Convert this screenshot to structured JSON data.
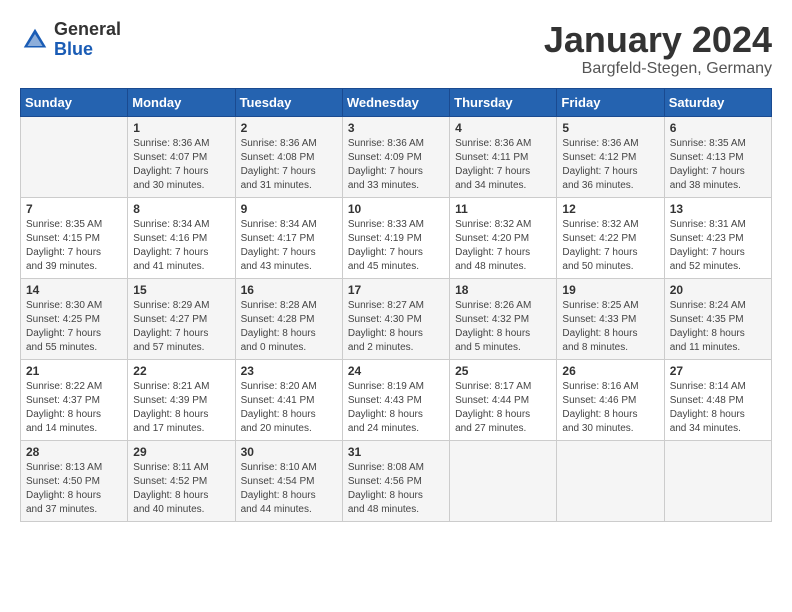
{
  "logo": {
    "general": "General",
    "blue": "Blue"
  },
  "title": {
    "month": "January 2024",
    "location": "Bargfeld-Stegen, Germany"
  },
  "days_of_week": [
    "Sunday",
    "Monday",
    "Tuesday",
    "Wednesday",
    "Thursday",
    "Friday",
    "Saturday"
  ],
  "weeks": [
    [
      {
        "day": "",
        "info": ""
      },
      {
        "day": "1",
        "info": "Sunrise: 8:36 AM\nSunset: 4:07 PM\nDaylight: 7 hours\nand 30 minutes."
      },
      {
        "day": "2",
        "info": "Sunrise: 8:36 AM\nSunset: 4:08 PM\nDaylight: 7 hours\nand 31 minutes."
      },
      {
        "day": "3",
        "info": "Sunrise: 8:36 AM\nSunset: 4:09 PM\nDaylight: 7 hours\nand 33 minutes."
      },
      {
        "day": "4",
        "info": "Sunrise: 8:36 AM\nSunset: 4:11 PM\nDaylight: 7 hours\nand 34 minutes."
      },
      {
        "day": "5",
        "info": "Sunrise: 8:36 AM\nSunset: 4:12 PM\nDaylight: 7 hours\nand 36 minutes."
      },
      {
        "day": "6",
        "info": "Sunrise: 8:35 AM\nSunset: 4:13 PM\nDaylight: 7 hours\nand 38 minutes."
      }
    ],
    [
      {
        "day": "7",
        "info": "Sunrise: 8:35 AM\nSunset: 4:15 PM\nDaylight: 7 hours\nand 39 minutes."
      },
      {
        "day": "8",
        "info": "Sunrise: 8:34 AM\nSunset: 4:16 PM\nDaylight: 7 hours\nand 41 minutes."
      },
      {
        "day": "9",
        "info": "Sunrise: 8:34 AM\nSunset: 4:17 PM\nDaylight: 7 hours\nand 43 minutes."
      },
      {
        "day": "10",
        "info": "Sunrise: 8:33 AM\nSunset: 4:19 PM\nDaylight: 7 hours\nand 45 minutes."
      },
      {
        "day": "11",
        "info": "Sunrise: 8:32 AM\nSunset: 4:20 PM\nDaylight: 7 hours\nand 48 minutes."
      },
      {
        "day": "12",
        "info": "Sunrise: 8:32 AM\nSunset: 4:22 PM\nDaylight: 7 hours\nand 50 minutes."
      },
      {
        "day": "13",
        "info": "Sunrise: 8:31 AM\nSunset: 4:23 PM\nDaylight: 7 hours\nand 52 minutes."
      }
    ],
    [
      {
        "day": "14",
        "info": "Sunrise: 8:30 AM\nSunset: 4:25 PM\nDaylight: 7 hours\nand 55 minutes."
      },
      {
        "day": "15",
        "info": "Sunrise: 8:29 AM\nSunset: 4:27 PM\nDaylight: 7 hours\nand 57 minutes."
      },
      {
        "day": "16",
        "info": "Sunrise: 8:28 AM\nSunset: 4:28 PM\nDaylight: 8 hours\nand 0 minutes."
      },
      {
        "day": "17",
        "info": "Sunrise: 8:27 AM\nSunset: 4:30 PM\nDaylight: 8 hours\nand 2 minutes."
      },
      {
        "day": "18",
        "info": "Sunrise: 8:26 AM\nSunset: 4:32 PM\nDaylight: 8 hours\nand 5 minutes."
      },
      {
        "day": "19",
        "info": "Sunrise: 8:25 AM\nSunset: 4:33 PM\nDaylight: 8 hours\nand 8 minutes."
      },
      {
        "day": "20",
        "info": "Sunrise: 8:24 AM\nSunset: 4:35 PM\nDaylight: 8 hours\nand 11 minutes."
      }
    ],
    [
      {
        "day": "21",
        "info": "Sunrise: 8:22 AM\nSunset: 4:37 PM\nDaylight: 8 hours\nand 14 minutes."
      },
      {
        "day": "22",
        "info": "Sunrise: 8:21 AM\nSunset: 4:39 PM\nDaylight: 8 hours\nand 17 minutes."
      },
      {
        "day": "23",
        "info": "Sunrise: 8:20 AM\nSunset: 4:41 PM\nDaylight: 8 hours\nand 20 minutes."
      },
      {
        "day": "24",
        "info": "Sunrise: 8:19 AM\nSunset: 4:43 PM\nDaylight: 8 hours\nand 24 minutes."
      },
      {
        "day": "25",
        "info": "Sunrise: 8:17 AM\nSunset: 4:44 PM\nDaylight: 8 hours\nand 27 minutes."
      },
      {
        "day": "26",
        "info": "Sunrise: 8:16 AM\nSunset: 4:46 PM\nDaylight: 8 hours\nand 30 minutes."
      },
      {
        "day": "27",
        "info": "Sunrise: 8:14 AM\nSunset: 4:48 PM\nDaylight: 8 hours\nand 34 minutes."
      }
    ],
    [
      {
        "day": "28",
        "info": "Sunrise: 8:13 AM\nSunset: 4:50 PM\nDaylight: 8 hours\nand 37 minutes."
      },
      {
        "day": "29",
        "info": "Sunrise: 8:11 AM\nSunset: 4:52 PM\nDaylight: 8 hours\nand 40 minutes."
      },
      {
        "day": "30",
        "info": "Sunrise: 8:10 AM\nSunset: 4:54 PM\nDaylight: 8 hours\nand 44 minutes."
      },
      {
        "day": "31",
        "info": "Sunrise: 8:08 AM\nSunset: 4:56 PM\nDaylight: 8 hours\nand 48 minutes."
      },
      {
        "day": "",
        "info": ""
      },
      {
        "day": "",
        "info": ""
      },
      {
        "day": "",
        "info": ""
      }
    ]
  ]
}
